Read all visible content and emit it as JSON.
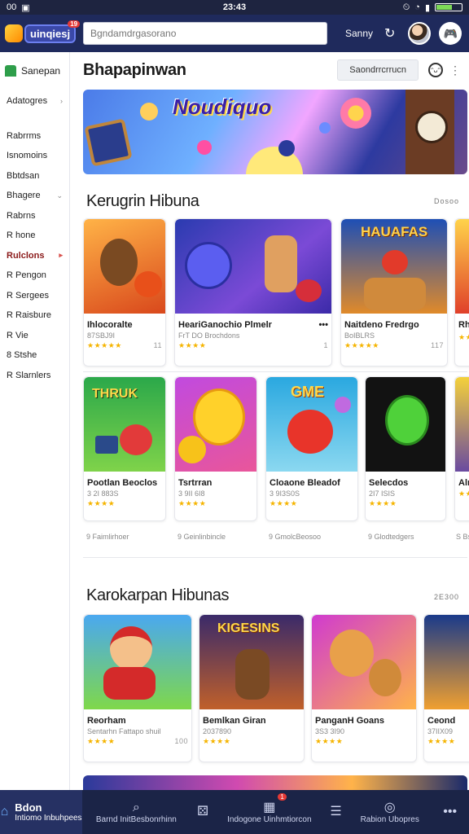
{
  "status_bar": {
    "left": "00",
    "time": "23:43"
  },
  "header": {
    "logo_text": "uinqiesj",
    "logo_badge": "19",
    "search_placeholder": "Bgndamdrgasorano",
    "label": "Sanny",
    "refresh_icon": "refresh-icon",
    "avatar_icon": "avatar",
    "profile_icon": "gamepad-icon"
  },
  "sidebar": {
    "head_label": "Sanepan",
    "items": [
      {
        "label": "Adatogres",
        "chevron": true,
        "active": false
      },
      {
        "label": "Rabrrms",
        "chevron": false,
        "active": false
      },
      {
        "label": "Isnomoins",
        "chevron": false,
        "active": false
      },
      {
        "label": "Bbtdsan",
        "chevron": false,
        "active": false
      },
      {
        "label": "Bhagere",
        "chevron": true,
        "active": false
      },
      {
        "label": "Rabrns",
        "chevron": false,
        "active": false
      },
      {
        "label": "R hone",
        "chevron": false,
        "active": false
      },
      {
        "label": "Rulclons",
        "chevron": true,
        "active": true
      },
      {
        "label": "R Pengon",
        "chevron": false,
        "active": false
      },
      {
        "label": "R Sergees",
        "chevron": false,
        "active": false
      },
      {
        "label": "R Raisbure",
        "chevron": false,
        "active": false
      },
      {
        "label": "R Vie",
        "chevron": false,
        "active": false
      },
      {
        "label": "8 Stshe",
        "chevron": false,
        "active": false
      },
      {
        "label": "R Slarnlers",
        "chevron": false,
        "active": false
      }
    ]
  },
  "main": {
    "title": "Bhapapinwan",
    "action_button": "Saondrrcrrucn",
    "banner_title": "Noudiquo",
    "section1": {
      "title": "Kerugrin Hibuna",
      "more": "Dosoo",
      "row1": [
        {
          "title": "Ihlocoralte",
          "sub": "87SBJ9I",
          "stars": "★★★★★",
          "count": "11"
        },
        {
          "title": "HeariGanochio Plmelr",
          "sub": "FrT DO Brochdons",
          "stars": "★★★★",
          "count": "1"
        },
        {
          "title": "Naitdeno Fredrgo",
          "sub": "BoIBLRS",
          "stars": "★★★★★",
          "count": "117"
        },
        {
          "title": "Rhi",
          "sub": "",
          "stars": "★★",
          "count": ""
        }
      ],
      "row2": [
        {
          "title": "Pootlan Beoclos",
          "sub": "3 2I 883S",
          "stars": "★★★★",
          "count": "",
          "tag": "9 Faimlirhoer"
        },
        {
          "title": "Tsrtrran",
          "sub": "3 9II 6I8",
          "stars": "★★★★",
          "count": "",
          "tag": "9 Geinlinbincle"
        },
        {
          "title": "Cloaone Bleadof",
          "sub": "3 9I3S0S",
          "stars": "★★★★",
          "count": "",
          "tag": "9 GmolcBeosoo"
        },
        {
          "title": "Selecdos",
          "sub": "2I7 ISIS",
          "stars": "★★★★",
          "count": "",
          "tag": "9 Glodtedgers"
        },
        {
          "title": "Alrl",
          "sub": "",
          "stars": "★★",
          "count": "",
          "tag": "S Bs"
        }
      ]
    },
    "section2": {
      "title": "Karokarpan Hibunas",
      "more": "2E300",
      "row": [
        {
          "title": "Reorham",
          "sub": "Sentarhn Fattapo shuil",
          "stars": "★★★★",
          "count": "100"
        },
        {
          "title": "Bemlkan Giran",
          "sub": "2037890",
          "stars": "★★★★",
          "count": ""
        },
        {
          "title": "PanganH Goans",
          "sub": "3S3 3I90",
          "stars": "★★★★",
          "count": ""
        },
        {
          "title": "Ceond",
          "sub": "37IIX09",
          "stars": "★★★★",
          "count": ""
        }
      ]
    }
  },
  "bottom_nav": [
    {
      "icon": "home-icon",
      "glyph": "⌂",
      "label": "Bdon",
      "sub": "Intiomo Inbuhpees",
      "active": true
    },
    {
      "icon": "search-icon",
      "glyph": "⌕",
      "label": "Barnd InitBesbonrhinn",
      "active": false
    },
    {
      "icon": "gamepad-icon",
      "glyph": "⚄",
      "label": "",
      "active": false
    },
    {
      "icon": "controller-icon",
      "glyph": "▦",
      "label": "Indogone Uinhmtiorcon",
      "badge": "1",
      "active": false
    },
    {
      "icon": "list-icon",
      "glyph": "☰",
      "label": "",
      "active": false
    },
    {
      "icon": "settings-icon",
      "glyph": "◎",
      "label": "Rabion Ubopres",
      "active": false
    },
    {
      "icon": "more-icon",
      "glyph": "•••",
      "label": "",
      "active": false
    }
  ],
  "colors": {
    "topbar": "#1f2a5c",
    "bottom_nav": "#1b2447",
    "accent": "#3a48a8",
    "star": "#f5b400"
  }
}
